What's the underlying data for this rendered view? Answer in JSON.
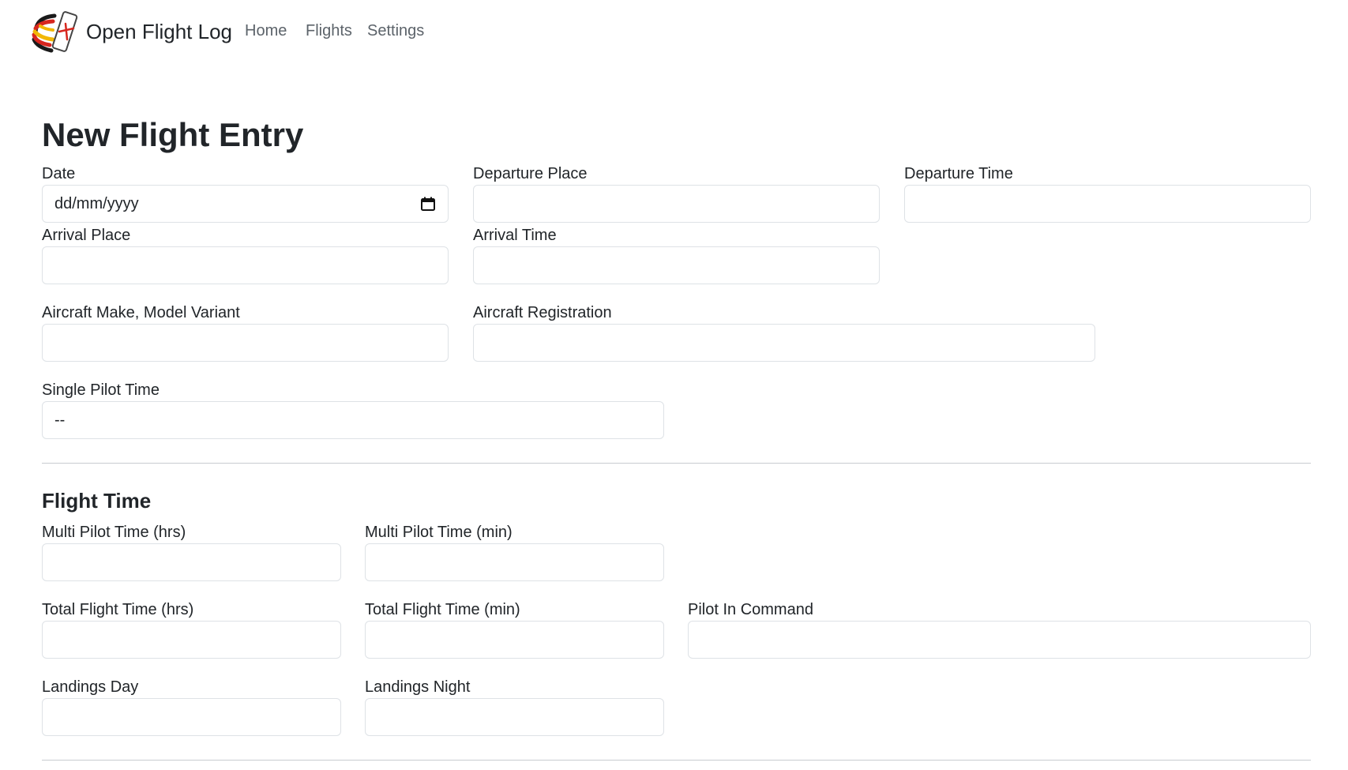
{
  "app": {
    "title": "Open Flight Log",
    "logo_icon": "globe-plane-logo-icon"
  },
  "nav": {
    "home": "Home",
    "flights": "Flights",
    "settings": "Settings"
  },
  "page": {
    "title": "New Flight Entry"
  },
  "form": {
    "date": {
      "label": "Date",
      "placeholder": "dd/mm/yyyy",
      "value": ""
    },
    "departure_place": {
      "label": "Departure Place",
      "value": ""
    },
    "departure_time": {
      "label": "Departure Time",
      "value": ""
    },
    "arrival_place": {
      "label": "Arrival Place",
      "value": ""
    },
    "arrival_time": {
      "label": "Arrival Time",
      "value": ""
    },
    "aircraft_model": {
      "label": "Aircraft Make, Model Variant",
      "value": ""
    },
    "aircraft_registration": {
      "label": "Aircraft Registration",
      "value": ""
    },
    "single_pilot_time": {
      "label": "Single Pilot Time",
      "selected": "--"
    }
  },
  "flight_time": {
    "heading": "Flight Time",
    "multi_pilot_hrs": {
      "label": "Multi Pilot Time (hrs)",
      "value": ""
    },
    "multi_pilot_min": {
      "label": "Multi Pilot Time (min)",
      "value": ""
    },
    "total_flight_hrs": {
      "label": "Total Flight Time (hrs)",
      "value": ""
    },
    "total_flight_min": {
      "label": "Total Flight Time (min)",
      "value": ""
    },
    "pilot_in_command": {
      "label": "Pilot In Command",
      "value": ""
    },
    "landings_day": {
      "label": "Landings Day",
      "value": ""
    },
    "landings_night": {
      "label": "Landings Night",
      "value": ""
    }
  }
}
